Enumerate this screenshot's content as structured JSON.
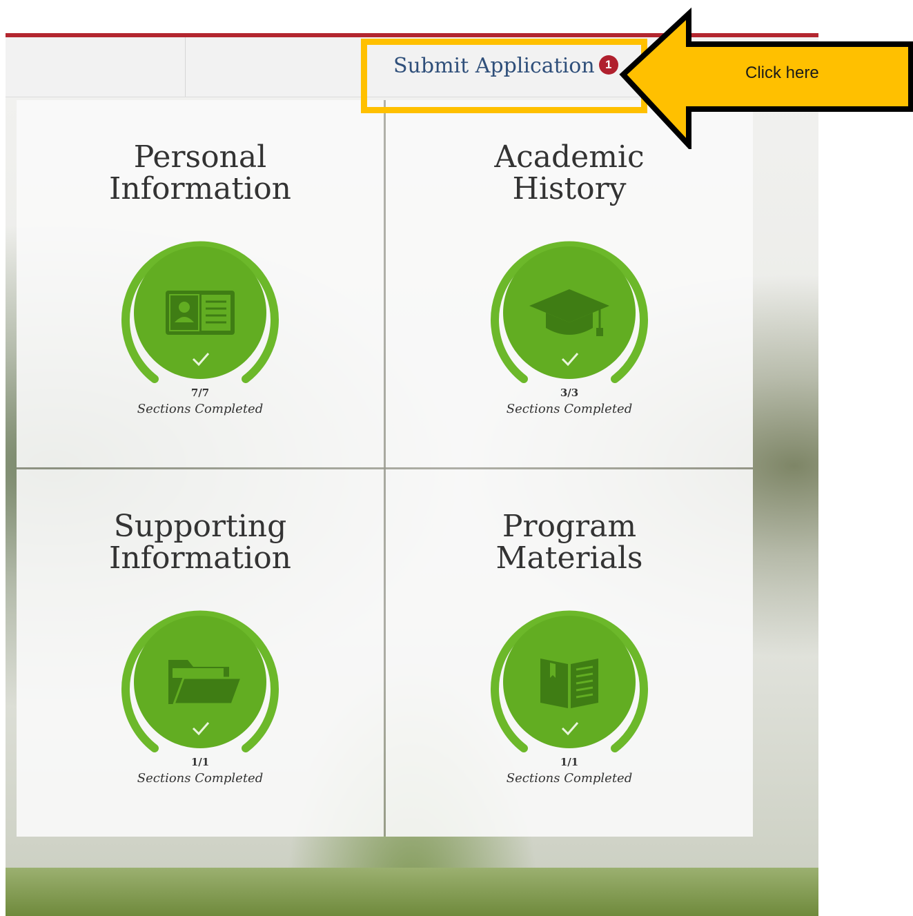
{
  "instruction_heading": "",
  "nav": {
    "submit_label": "Submit Application",
    "submit_badge": "1"
  },
  "callout": {
    "text": "Click here",
    "color": "#ffc000"
  },
  "tiles": [
    {
      "title_line1": "Personal",
      "title_line2": "Information",
      "count": "7/7",
      "caption": "Sections Completed",
      "icon": "id-card-icon",
      "progress": 1.0
    },
    {
      "title_line1": "Academic",
      "title_line2": "History",
      "count": "3/3",
      "caption": "Sections Completed",
      "icon": "graduation-cap-icon",
      "progress": 1.0
    },
    {
      "title_line1": "Supporting",
      "title_line2": "Information",
      "count": "1/1",
      "caption": "Sections Completed",
      "icon": "folder-icon",
      "progress": 1.0
    },
    {
      "title_line1": "Program",
      "title_line2": "Materials",
      "count": "1/1",
      "caption": "Sections Completed",
      "icon": "book-icon",
      "progress": 1.0
    }
  ],
  "colors": {
    "accent_green": "#5aa51e",
    "ring_green": "#6cb82a",
    "brand_red": "#b3262f"
  }
}
